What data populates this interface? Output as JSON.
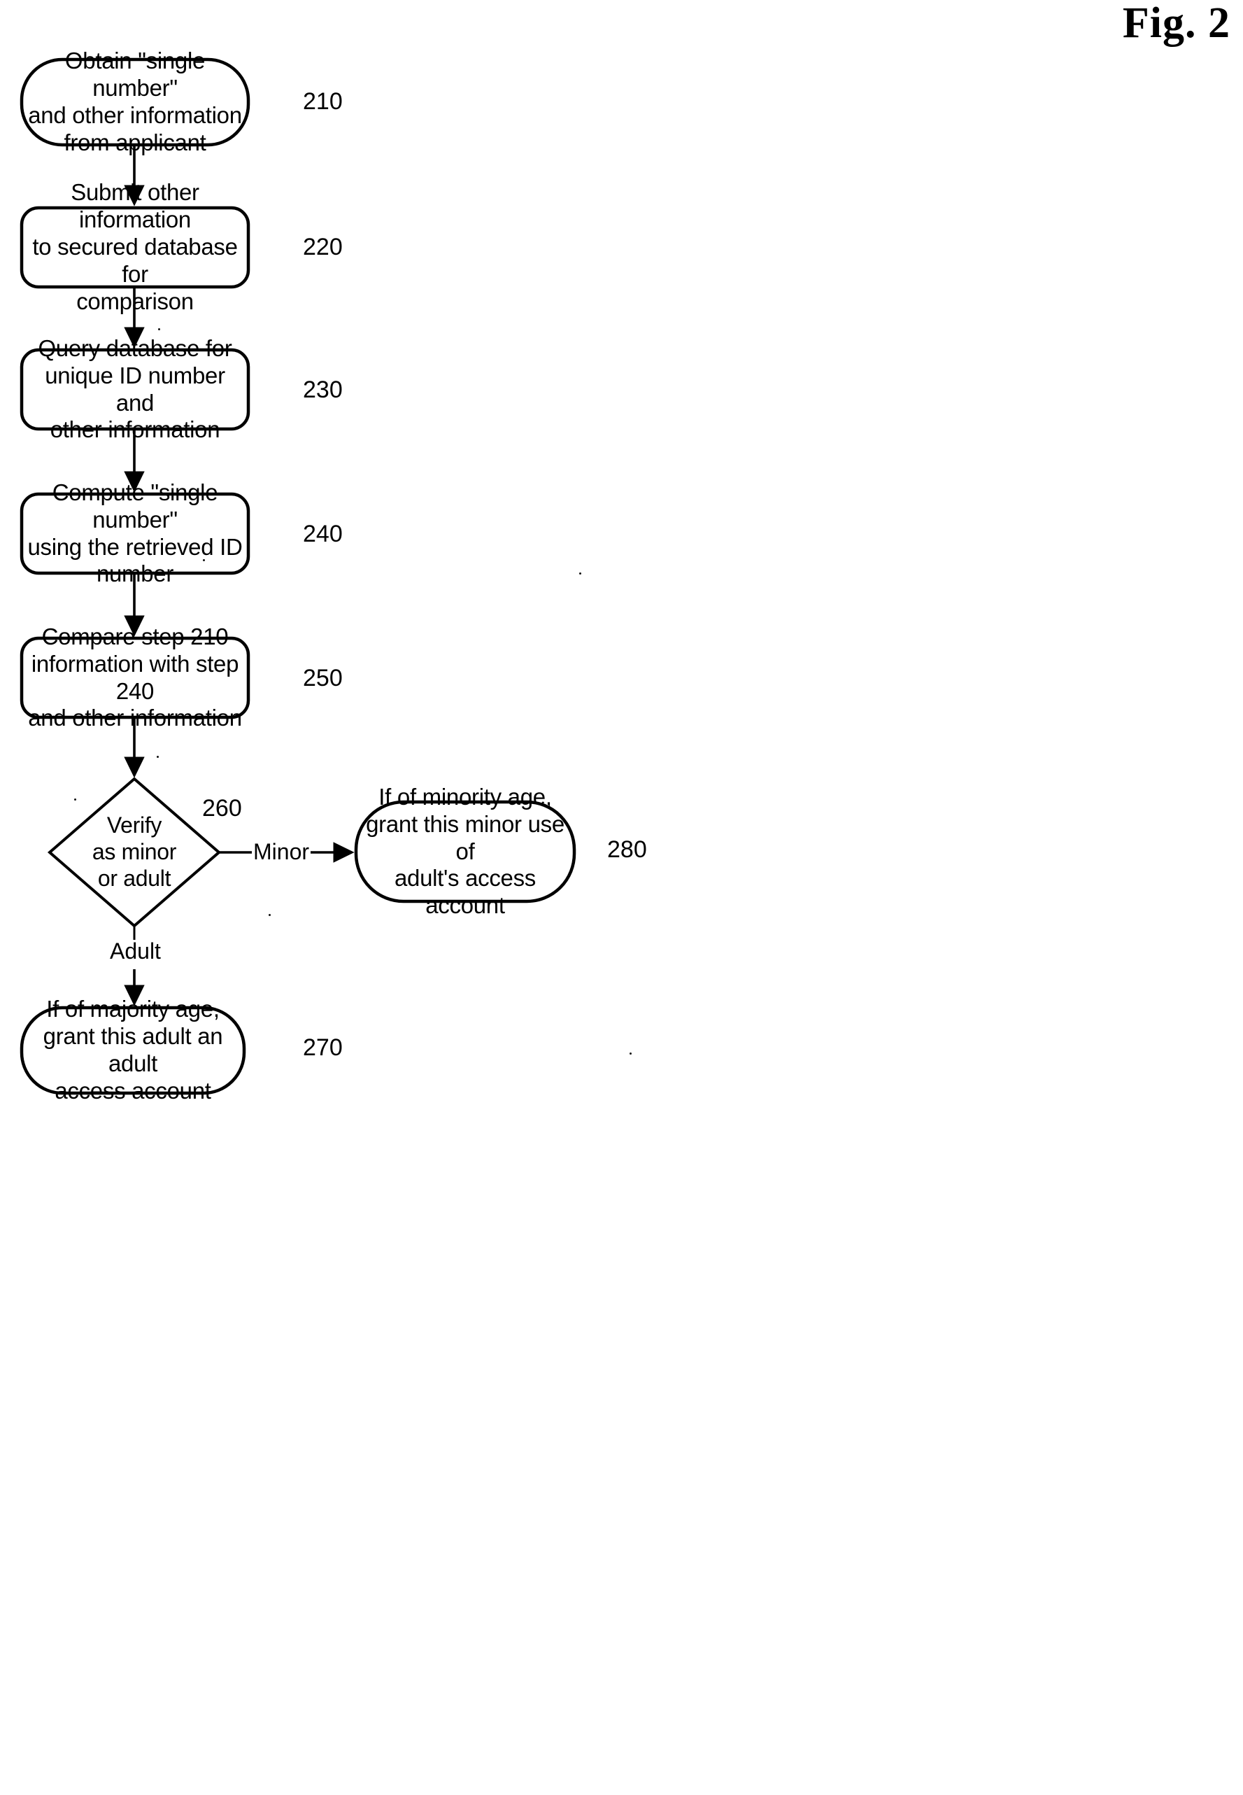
{
  "figure": {
    "title": "Fig. 2"
  },
  "nodes": [
    {
      "id": "210",
      "shape": "stadium",
      "text": "Obtain \"single number\"\nand other information\nfrom applicant",
      "ref": "210"
    },
    {
      "id": "220",
      "shape": "rounded-rect",
      "text": "Submit other information\nto secured database for\ncomparison",
      "ref": "220"
    },
    {
      "id": "230",
      "shape": "rounded-rect",
      "text": "Query database for\nunique ID number and\nother information",
      "ref": "230"
    },
    {
      "id": "240",
      "shape": "rounded-rect",
      "text": "Compute \"single number\"\nusing the retrieved ID\nnumber",
      "ref": "240"
    },
    {
      "id": "250",
      "shape": "rounded-rect",
      "text": "Compare step 210\ninformation with step 240\nand other information",
      "ref": "250"
    },
    {
      "id": "260",
      "shape": "diamond",
      "text": "Verify\nas minor\nor adult",
      "ref": "260"
    },
    {
      "id": "280",
      "shape": "stadium",
      "text": "If of minority age,\ngrant this minor use of\nadult's access account",
      "ref": "280"
    },
    {
      "id": "270",
      "shape": "stadium",
      "text": "If of majority age,\ngrant this adult an adult\naccess account",
      "ref": "270"
    }
  ],
  "edges": [
    {
      "from": "210",
      "to": "220",
      "label": ""
    },
    {
      "from": "220",
      "to": "230",
      "label": ""
    },
    {
      "from": "230",
      "to": "240",
      "label": ""
    },
    {
      "from": "240",
      "to": "250",
      "label": ""
    },
    {
      "from": "250",
      "to": "260",
      "label": ""
    },
    {
      "from": "260",
      "to": "280",
      "label": "Minor"
    },
    {
      "from": "260",
      "to": "270",
      "label": "Adult"
    }
  ]
}
